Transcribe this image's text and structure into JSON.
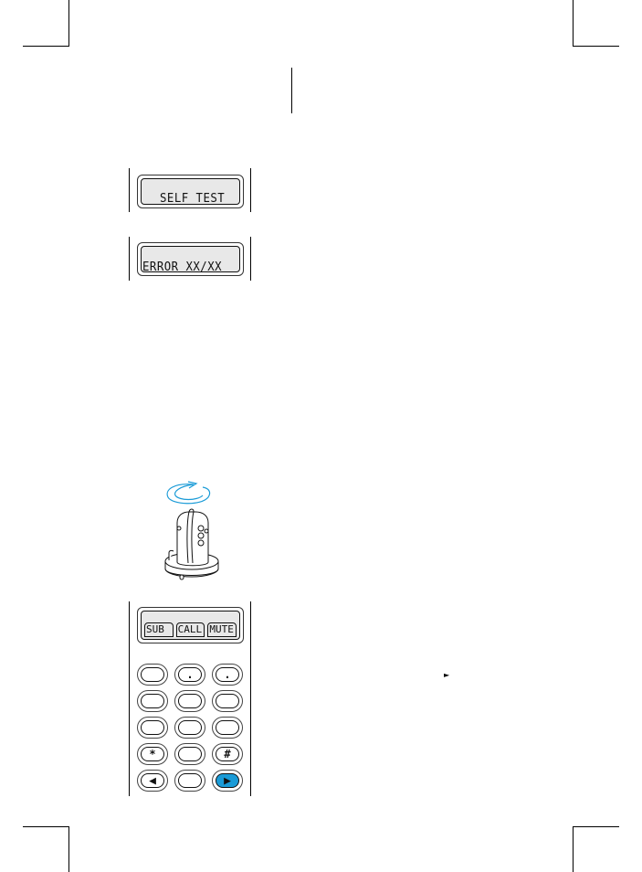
{
  "page": {
    "type": "manual-page-figures",
    "background": "#ffffff"
  },
  "figures": {
    "self_test_display": {
      "text": "SELF TEST"
    },
    "error_display": {
      "text": "ERROR XX/XX"
    },
    "radio_charger_illustration": {
      "description": "Radio rotating in desktop charger",
      "rotation_arrow_color": "#1a9bd7",
      "icon": "rotate-arrow-icon"
    },
    "keypad_display": {
      "softkeys": [
        "SUB",
        "CALL",
        "MUTE"
      ]
    },
    "keypad": {
      "rows": [
        [
          {
            "label": ""
          },
          {
            "label": "."
          },
          {
            "label": "."
          }
        ],
        [
          {
            "label": ""
          },
          {
            "label": ""
          },
          {
            "label": ""
          }
        ],
        [
          {
            "label": ""
          },
          {
            "label": ""
          },
          {
            "label": ""
          }
        ],
        [
          {
            "label": "*"
          },
          {
            "label": ""
          },
          {
            "label": "#"
          }
        ],
        [
          {
            "label": "◀",
            "icon": "left-arrow-icon"
          },
          {
            "label": ""
          },
          {
            "label": "▶",
            "icon": "right-arrow-icon",
            "highlighted": true
          }
        ]
      ],
      "highlight_color": "#1a9bd7"
    },
    "inline_marker": {
      "glyph": "►",
      "icon": "right-pointer-icon"
    }
  }
}
